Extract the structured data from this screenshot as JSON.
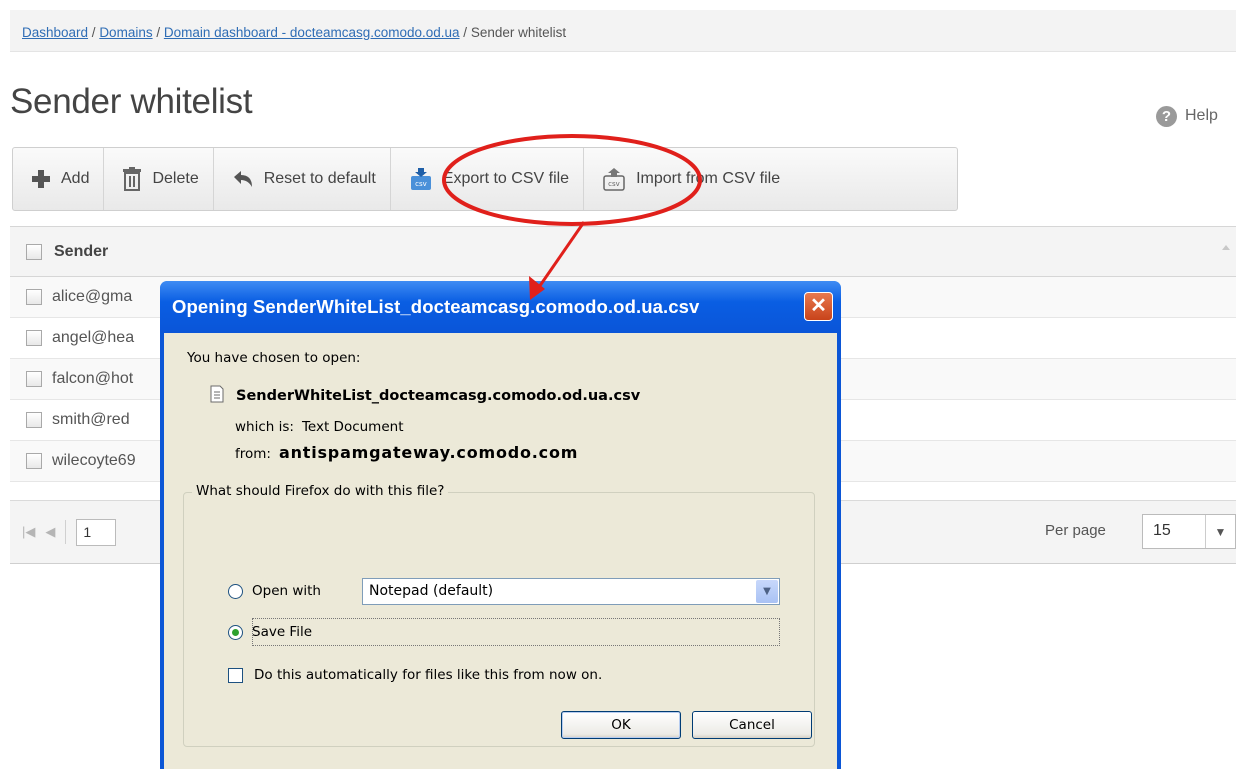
{
  "breadcrumb": {
    "dashboard": "Dashboard",
    "domains": "Domains",
    "domain_dashboard": "Domain dashboard - docteamcasg.comodo.od.ua",
    "current": "Sender whitelist",
    "separator": " / "
  },
  "page": {
    "title": "Sender whitelist",
    "help_label": "Help"
  },
  "toolbar": {
    "add_label": "Add",
    "delete_label": "Delete",
    "reset_label": "Reset to default",
    "export_label": "Export to CSV file",
    "import_label": "Import from CSV file"
  },
  "table": {
    "header": "Sender",
    "rows": [
      "alice@gma",
      "angel@hea",
      "falcon@hot",
      "smith@red",
      "wilecoyte69"
    ]
  },
  "pager": {
    "page_value": "1",
    "per_page_label": "Per page",
    "per_page_value": "15"
  },
  "dialog": {
    "title": "Opening SenderWhiteList_docteamcasg.comodo.od.ua.csv",
    "chosen_text": "You have chosen to open:",
    "filename": "SenderWhiteList_docteamcasg.comodo.od.ua.csv",
    "which_is_label": "which is:",
    "which_is_value": "Text Document",
    "from_label": "from:",
    "from_value": "antispamgateway.comodo.com",
    "question": "What should Firefox do with this file?",
    "open_with_label": "Open with",
    "open_with_app": "Notepad (default)",
    "save_file_label": "Save File",
    "auto_label": "Do this automatically for files like this from now on.",
    "ok_label": "OK",
    "cancel_label": "Cancel",
    "close_glyph": "✕"
  },
  "colors": {
    "link": "#2f6db5",
    "dialog_title_bg": "#0a5ee3",
    "annotation": "#e0201b"
  }
}
